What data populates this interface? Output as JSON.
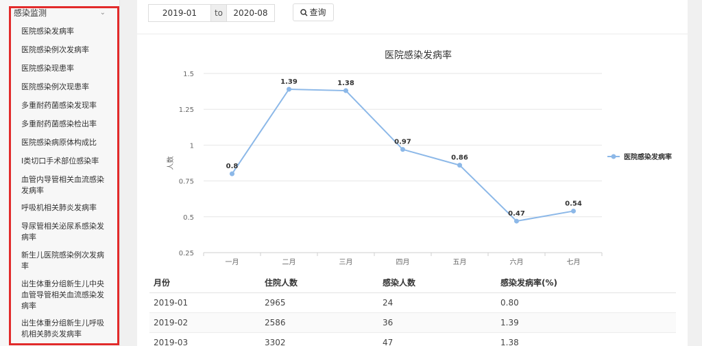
{
  "sidebar": {
    "section_label": "感染监测",
    "items": [
      {
        "label": "医院感染发病率"
      },
      {
        "label": "医院感染例次发病率"
      },
      {
        "label": "医院感染现患率"
      },
      {
        "label": "医院感染例次现患率"
      },
      {
        "label": "多重耐药菌感染发现率"
      },
      {
        "label": "多重耐药菌感染检出率"
      },
      {
        "label": "医院感染病原体构成比"
      },
      {
        "label": "I类切口手术部位感染率"
      },
      {
        "label": "血管内导管相关血流感染发病率"
      },
      {
        "label": "呼吸机相关肺炎发病率"
      },
      {
        "label": "导尿管相关泌尿系感染发病率"
      },
      {
        "label": "新生儿医院感染例次发病率"
      },
      {
        "label": "出生体重分组新生儿中央血管导管相关血流感染发病率"
      },
      {
        "label": "出生体重分组新生儿呼吸机相关肺炎发病率"
      }
    ]
  },
  "filter": {
    "start_date": "2019-01",
    "separator": "to",
    "end_date": "2020-08",
    "query_label": "查询"
  },
  "chart_data": {
    "type": "line",
    "title": "医院感染发病率",
    "ylabel": "人数",
    "xlabel": "",
    "categories": [
      "一月",
      "二月",
      "三月",
      "四月",
      "五月",
      "六月",
      "七月"
    ],
    "series": [
      {
        "name": "医院感染发病率",
        "values": [
          0.8,
          1.39,
          1.38,
          0.97,
          0.86,
          0.47,
          0.54
        ],
        "color": "#8cb8e8"
      }
    ],
    "ylim": [
      0.25,
      1.5
    ],
    "yticks": [
      "1.5",
      "1.25",
      "1",
      "0.75",
      "0.5",
      "0.25"
    ],
    "legend": "right",
    "grid": true
  },
  "table": {
    "headers": [
      "月份",
      "住院人数",
      "感染人数",
      "感染发病率(%)"
    ],
    "rows": [
      [
        "2019-01",
        "2965",
        "24",
        "0.80"
      ],
      [
        "2019-02",
        "2586",
        "36",
        "1.39"
      ],
      [
        "2019-03",
        "3302",
        "47",
        "1.38"
      ]
    ]
  },
  "colors": {
    "highlight_border": "#e22a2a",
    "series_line": "#8cb8e8"
  }
}
